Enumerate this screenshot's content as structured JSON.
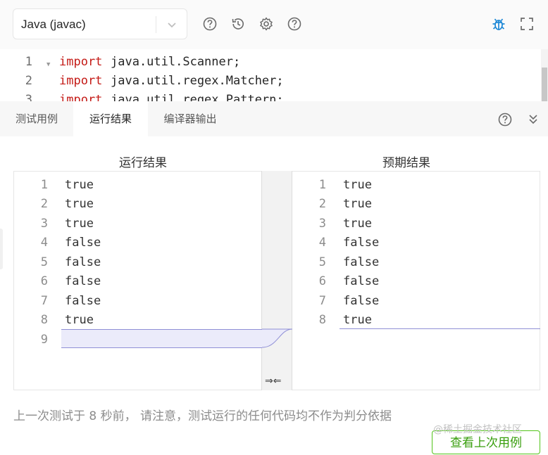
{
  "toolbar": {
    "language": "Java (javac)",
    "icons": [
      "help-icon",
      "history-icon",
      "gear-icon",
      "help-icon",
      "bug-icon",
      "fullscreen-icon"
    ],
    "accent_color": "#1e88d6"
  },
  "editor": {
    "lines": [
      {
        "num": "1",
        "kw": "import",
        "rest": "java.util.Scanner;"
      },
      {
        "num": "2",
        "kw": "import",
        "rest": "java.util.regex.Matcher;"
      },
      {
        "num": "3",
        "kw": "import",
        "rest": "java.util.regex.Pattern;"
      }
    ]
  },
  "tabs": [
    {
      "label": "测试用例"
    },
    {
      "label": "运行结果"
    },
    {
      "label": "编译器输出"
    }
  ],
  "result": {
    "actual_title": "运行结果",
    "expected_title": "预期结果",
    "actual": [
      {
        "num": "1",
        "text": "true"
      },
      {
        "num": "2",
        "text": "true"
      },
      {
        "num": "3",
        "text": "true"
      },
      {
        "num": "4",
        "text": "false"
      },
      {
        "num": "5",
        "text": "false"
      },
      {
        "num": "6",
        "text": "false"
      },
      {
        "num": "7",
        "text": "false"
      },
      {
        "num": "8",
        "text": "true"
      },
      {
        "num": "9",
        "text": ""
      }
    ],
    "expected": [
      {
        "num": "1",
        "text": "true"
      },
      {
        "num": "2",
        "text": "true"
      },
      {
        "num": "3",
        "text": "true"
      },
      {
        "num": "4",
        "text": "false"
      },
      {
        "num": "5",
        "text": "false"
      },
      {
        "num": "6",
        "text": "false"
      },
      {
        "num": "7",
        "text": "false"
      },
      {
        "num": "8",
        "text": "true"
      }
    ],
    "merge_symbol": "⇒⇐",
    "diff_color": "#8f8fd6"
  },
  "footer": {
    "note": "上一次测试于 8 秒前， 请注意，测试运行的任何代码均不作为判分依据",
    "watermark": "@稀土掘金技术社区",
    "view_last_button": "查看上次用例",
    "button_color": "#52c41a"
  }
}
